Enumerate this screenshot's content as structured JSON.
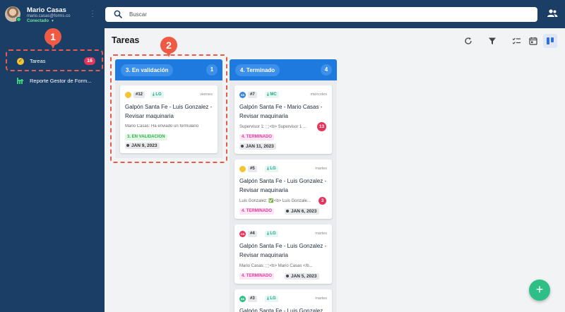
{
  "user": {
    "name": "Mario Casas",
    "email": "mario.casas@forms.co",
    "status": "Conectado"
  },
  "sidebar": {
    "items": [
      {
        "label": "Tareas",
        "badge": "16"
      },
      {
        "label": "Reporte Gestor de Form..."
      }
    ]
  },
  "search": {
    "placeholder": "Buscar"
  },
  "page": {
    "title": "Tareas"
  },
  "annotations": [
    "1",
    "2"
  ],
  "columns": [
    {
      "title": "3. En validación",
      "count": "1",
      "color": "#1f7ae0",
      "cards": [
        {
          "dot_color": "#f4c531",
          "dot_label": "",
          "id": "#12",
          "assignee": "LG",
          "day": "viernes",
          "title": "Galpón Santa Fe - Luis Gonzalez - Revisar maquinaria",
          "message": "Mario Casas: Ha enviado un formulario",
          "status": "3. EN VALIDACION",
          "date": "JAN 9, 2023"
        }
      ]
    },
    {
      "title": "4. Terminado",
      "count": "4",
      "color": "#1f7ae0",
      "cards": [
        {
          "dot_color": "#3a86d8",
          "dot_label": "SS",
          "id": "#7",
          "assignee": "MC",
          "day": "miércoles",
          "title": "Galpón Santa Fe - Mario Casas - Revisar maquinaria",
          "message": "Supervisor 1: ⬚<b> Supervisor 1 ...",
          "message_count": "13",
          "status": "4. TERMINADO",
          "date": "JAN 11, 2023"
        },
        {
          "dot_color": "#f4c531",
          "dot_label": "",
          "id": "#5",
          "assignee": "LG",
          "day": "martes",
          "title": "Galpón Santa Fe - Luis Gonzalez - Revisar maquinaria",
          "message": "Luis Gonzalez: ✅<b> Luis Gonzale...",
          "message_count": "3",
          "status": "4. TERMINADO",
          "date": "JAN 6, 2023"
        },
        {
          "dot_color": "#e6335a",
          "dot_label": "GS",
          "id": "#4",
          "assignee": "LG",
          "day": "martes",
          "title": "Galpón Santa Fe - Luis Gonzalez - Revisar maquinaria",
          "message": "Mario Casas: ⬚<b> Mario Casas </b...",
          "status": "4. TERMINADO",
          "date": "JAN 5, 2023"
        },
        {
          "dot_color": "#2dbf86",
          "dot_label": "SS",
          "id": "#3",
          "assignee": "LG",
          "day": "martes",
          "title": "Galpón Santa Fe - Luis Gonzalez",
          "message": "",
          "status": "",
          "date": ""
        }
      ]
    }
  ]
}
